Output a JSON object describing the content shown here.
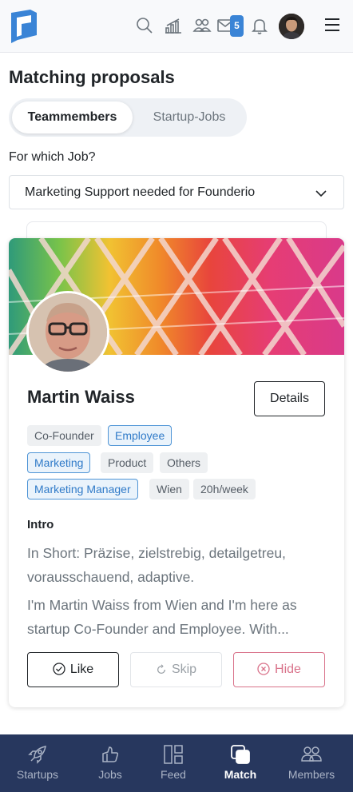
{
  "header": {
    "notification_count": "5",
    "icons": [
      "search-icon",
      "stats-icon",
      "users-icon",
      "mail-icon",
      "bell-icon",
      "avatar",
      "menu-icon"
    ]
  },
  "page": {
    "title": "Matching proposals",
    "tabs": [
      {
        "label": "Teammembers",
        "active": true
      },
      {
        "label": "Startup-Jobs",
        "active": false
      }
    ],
    "job_question": "For which Job?",
    "job_selected": "Marketing Support needed for Founderio"
  },
  "profile": {
    "name": "Martin Waiss",
    "details_label": "Details",
    "tags": [
      {
        "label": "Co-Founder",
        "style": "grey"
      },
      {
        "label": "Employee",
        "style": "blue"
      },
      {
        "label": "Marketing",
        "style": "blue"
      },
      {
        "label": "Product",
        "style": "grey"
      },
      {
        "label": "Others",
        "style": "grey"
      },
      {
        "label": "Marketing Manager",
        "style": "blue"
      },
      {
        "label": "Wien",
        "style": "grey"
      },
      {
        "label": "20h/week",
        "style": "grey"
      }
    ],
    "intro_title": "Intro",
    "intro_short": "In Short: Präzise, zielstrebig, detailgetreu, vorausschauend, adaptive.",
    "intro_text": "I'm Martin Waiss from Wien and I'm here as startup Co-Founder and Employee. With...",
    "actions": {
      "like": "Like",
      "skip": "Skip",
      "hide": "Hide"
    }
  },
  "bottom_nav": [
    {
      "label": "Startups",
      "icon": "rocket-icon",
      "active": false
    },
    {
      "label": "Jobs",
      "icon": "jobs-icon",
      "active": false
    },
    {
      "label": "Feed",
      "icon": "feed-icon",
      "active": false
    },
    {
      "label": "Match",
      "icon": "match-icon",
      "active": true
    },
    {
      "label": "Members",
      "icon": "members-icon",
      "active": false
    }
  ],
  "colors": {
    "accent_blue": "#3a84d6",
    "nav_background": "#27375e",
    "hide_red": "#d9728a"
  }
}
